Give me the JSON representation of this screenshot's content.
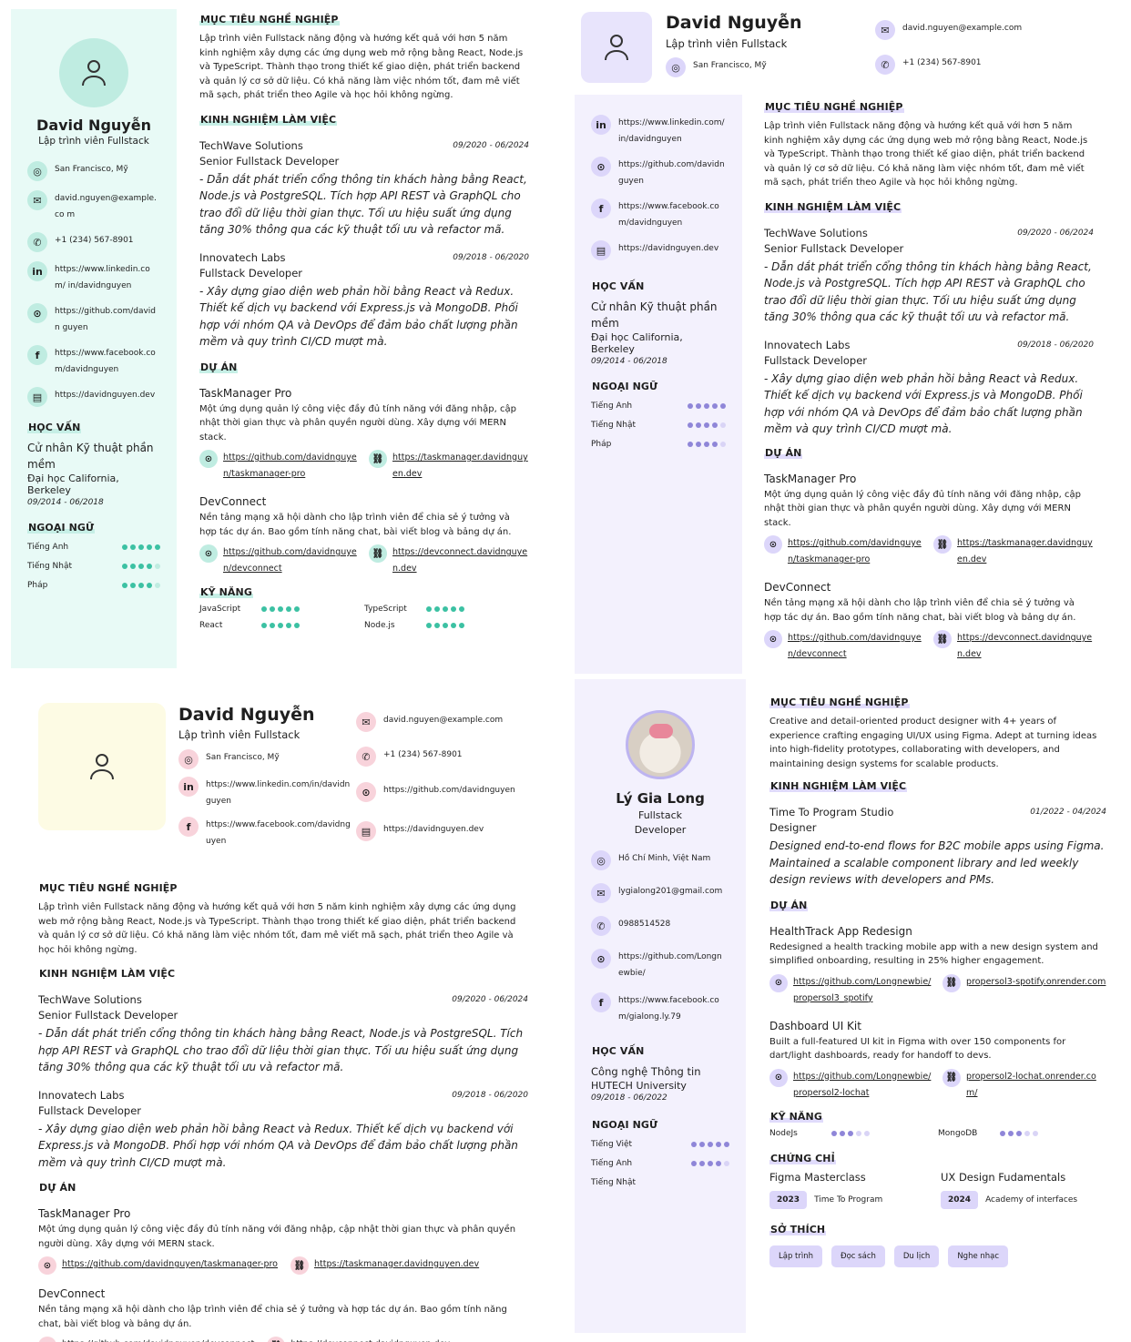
{
  "person": {
    "name": "David Nguyễn",
    "title": "Lập trình viên Fullstack",
    "location": "San Francisco, Mỹ",
    "email": "david.nguyen@example.com",
    "phone": "+1 (234) 567-8901",
    "linkedin": "https://www.linkedin.com/in/davidnguyen",
    "github": "https://github.com/davidnguyen",
    "facebook": "https://www.facebook.com/davidnguyen",
    "website": "https://davidnguyen.dev"
  },
  "panel1": {
    "email_wrapped": "david.nguyen@example.co m",
    "linkedin_wrapped": "https://www.linkedin.com/ in/davidnguyen",
    "github_wrapped": "https://github.com/davidn guyen",
    "facebook_wrapped": "https://www.facebook.co m/davidnguyen"
  },
  "labels": {
    "objective": "MỤC TIÊU NGHỀ NGHIỆP",
    "experience": "KINH NGHIỆM LÀM VIỆC",
    "projects": "DỰ ÁN",
    "skills": "KỸ NĂNG",
    "education": "HỌC VẤN",
    "languages": "NGOẠI NGỮ",
    "certificates": "CHỨNG CHỈ",
    "hobbies": "SỞ THÍCH"
  },
  "objective_text": "Lập trình viên Fullstack năng động và hướng kết quả với hơn 5 năm kinh nghiệm xây dựng các ứng dụng web mở rộng bằng React, Node.js và TypeScript. Thành thạo trong thiết kế giao diện, phát triển backend và quản lý cơ sở dữ liệu. Có khả năng làm việc nhóm tốt, đam mê viết mã sạch, phát triển theo Agile và học hỏi không ngừng.",
  "jobs": [
    {
      "company": "TechWave Solutions",
      "date": "09/2020 - 06/2024",
      "role": "Senior Fullstack Developer",
      "desc": "- Dẫn dắt phát triển cổng thông tin khách hàng bằng React, Node.js và PostgreSQL. Tích hợp API REST và GraphQL cho trao đổi dữ liệu thời gian thực. Tối ưu hiệu suất ứng dụng tăng 30% thông qua các kỹ thuật tối ưu và refactor mã."
    },
    {
      "company": "Innovatech Labs",
      "date": "09/2018 - 06/2020",
      "role": "Fullstack Developer",
      "desc": "- Xây dựng giao diện web phản hồi bằng React và Redux. Thiết kế dịch vụ backend với Express.js và MongoDB. Phối hợp với nhóm QA và DevOps để đảm bảo chất lượng phần mềm và quy trình CI/CD mượt mà."
    }
  ],
  "projects": [
    {
      "name": "TaskManager Pro",
      "desc": "Một ứng dụng quản lý công việc đầy đủ tính năng với đăng nhập, cập nhật thời gian thực và phân quyền người dùng. Xây dựng với MERN stack.",
      "repo": "https://github.com/davidnguyen/taskmanager-pro",
      "site": "https://taskmanager.davidnguyen.dev"
    },
    {
      "name": "DevConnect",
      "desc": "Nền tảng mạng xã hội dành cho lập trình viên để chia sẻ ý tưởng và hợp tác dự án. Bao gồm tính năng chat, bài viết blog và bảng dự án.",
      "repo": "https://github.com/davidnguyen/devconnect",
      "site": "https://devconnect.davidnguyen.dev"
    }
  ],
  "education": {
    "degree": "Cử nhân Kỹ thuật phần mềm",
    "school": "Đại học California, Berkeley",
    "date": "09/2014 - 06/2018"
  },
  "languages": [
    {
      "name": "Tiếng Anh",
      "level": 5
    },
    {
      "name": "Tiếng Nhật",
      "level": 4
    },
    {
      "name": "Pháp",
      "level": 4
    }
  ],
  "skills": [
    {
      "name": "JavaScript",
      "level": 5
    },
    {
      "name": "TypeScript",
      "level": 5
    },
    {
      "name": "React",
      "level": 5
    },
    {
      "name": "Node.js",
      "level": 5
    }
  ],
  "cv4": {
    "name": "Lý Gia Long",
    "title": "Fullstack Developer",
    "location": "Hồ Chí Minh, Việt Nam",
    "email": "lygialong201@gmail.com",
    "phone": "0988514528",
    "github": "https://github.com/Longn ewbie/",
    "facebook": "https://www.facebook.co m/gialong.ly.79",
    "objective": "Creative and detail-oriented product designer with 4+ years of experience crafting engaging UI/UX using Figma. Adept at turning ideas into high-fidelity prototypes, collaborating with developers, and maintaining design systems for scalable products.",
    "job": {
      "company": "Time To Program Studio",
      "date": "01/2022 - 04/2024",
      "role": "Designer",
      "desc": "Designed end-to-end flows for B2C mobile apps using Figma. Maintained a scalable component library and led weekly design reviews with developers and PMs."
    },
    "projects": [
      {
        "name": "HealthTrack App Redesign",
        "desc": "Redesigned a health tracking mobile app with a new design system and simplified onboarding, resulting in 25% higher engagement.",
        "repo": "https://github.com/Longnewbie/propersol3_spotify",
        "site": "propersol3-spotify.onrender.com"
      },
      {
        "name": "Dashboard UI Kit",
        "desc": "Built a full-featured UI kit in Figma with over 150 components for dart/light dashboards, ready for handoff to devs.",
        "repo": "https://github.com/Longnewbie/propersol2-lochat",
        "site": "propersol2-lochat.onrender.com/"
      }
    ],
    "education": {
      "degree": "Công nghệ Thông tin",
      "school": "HUTECH University",
      "date": "09/2018 - 06/2022"
    },
    "languages": [
      {
        "name": "Tiếng Việt",
        "level": 5
      },
      {
        "name": "Tiếng Anh",
        "level": 4
      },
      {
        "name": "Tiếng Nhật",
        "level": 0
      }
    ],
    "skills": [
      {
        "name": "NodeJs",
        "level": 3
      },
      {
        "name": "MongoDB",
        "level": 3
      }
    ],
    "certificates": [
      {
        "name": "Figma Masterclass",
        "year": "2023",
        "org": "Time To Program"
      },
      {
        "name": "UX Design Fudamentals",
        "year": "2024",
        "org": "Academy of interfaces"
      }
    ],
    "hobbies": [
      "Lập trình",
      "Đọc sách",
      "Du lịch",
      "Nghe nhạc"
    ]
  },
  "colors": {
    "teal": "#3cc1a3",
    "teal_light": "#e8faf6",
    "purple": "#8f86d8",
    "purple_light": "#f3f1fd",
    "pink": "#f8d3db",
    "cream": "#fdfbe4"
  },
  "icons": [
    "map-pin-icon",
    "mail-icon",
    "phone-icon",
    "linkedin-icon",
    "github-icon",
    "facebook-icon",
    "website-icon",
    "link-icon",
    "user-icon"
  ]
}
